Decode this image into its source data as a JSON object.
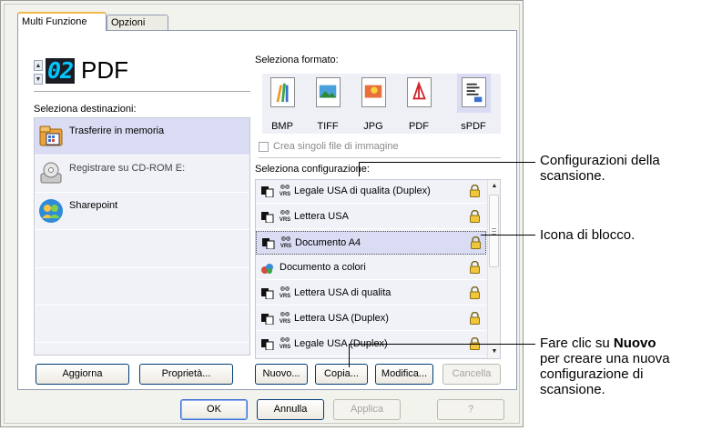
{
  "tabs": [
    "Multi Funzione",
    "Opzioni"
  ],
  "counter": {
    "value": "02",
    "format_name": "PDF"
  },
  "labels": {
    "destinations": "Seleziona destinazioni:",
    "format": "Seleziona formato:",
    "configuration": "Seleziona configurazione:",
    "single_files": "Crea singoli file di immagine"
  },
  "destinations": [
    {
      "label": "Trasferire in memoria",
      "icon": "memory-transfer-icon",
      "selected": true
    },
    {
      "label": "Registrare su CD-ROM  E:",
      "icon": "cd-rom-icon",
      "selected": false
    },
    {
      "label": "Sharepoint",
      "icon": "sharepoint-icon",
      "selected": false
    }
  ],
  "formats": [
    {
      "label": "BMP",
      "icon": "bmp-icon"
    },
    {
      "label": "TIFF",
      "icon": "tiff-icon"
    },
    {
      "label": "JPG",
      "icon": "jpg-icon"
    },
    {
      "label": "PDF",
      "icon": "pdf-icon"
    },
    {
      "label": "sPDF",
      "icon": "spdf-icon",
      "selected": true
    }
  ],
  "configurations": [
    {
      "label": "Legale USA di qualita (Duplex)",
      "type": "bw"
    },
    {
      "label": "Lettera USA",
      "type": "bw"
    },
    {
      "label": "Documento A4",
      "type": "bw",
      "selected": true
    },
    {
      "label": "Documento a colori",
      "type": "color"
    },
    {
      "label": "Lettera USA di qualita",
      "type": "bw"
    },
    {
      "label": "Lettera USA (Duplex)",
      "type": "bw"
    },
    {
      "label": "Legale USA (Duplex)",
      "type": "bw"
    }
  ],
  "buttons": {
    "update": "Aggiorna",
    "properties": "Proprietà...",
    "new": "Nuovo...",
    "copy": "Copia...",
    "modify": "Modifica...",
    "delete": "Cancella",
    "ok": "OK",
    "cancel": "Annulla",
    "apply": "Applica",
    "help": "?"
  },
  "callouts": {
    "config_line1": "Configurazioni della",
    "config_line2": "scansione.",
    "lock": "Icona di blocco.",
    "new_pre": "Fare clic su ",
    "new_bold": "Nuovo",
    "new_line2": "per creare una nuova",
    "new_line3": "configurazione di",
    "new_line4": "scansione."
  },
  "colors": {
    "selection": "#d9dcf2",
    "list_bg": "#f1f2f7",
    "lcd_text": "#00c8ff",
    "tab_accent": "#f0b84a"
  }
}
